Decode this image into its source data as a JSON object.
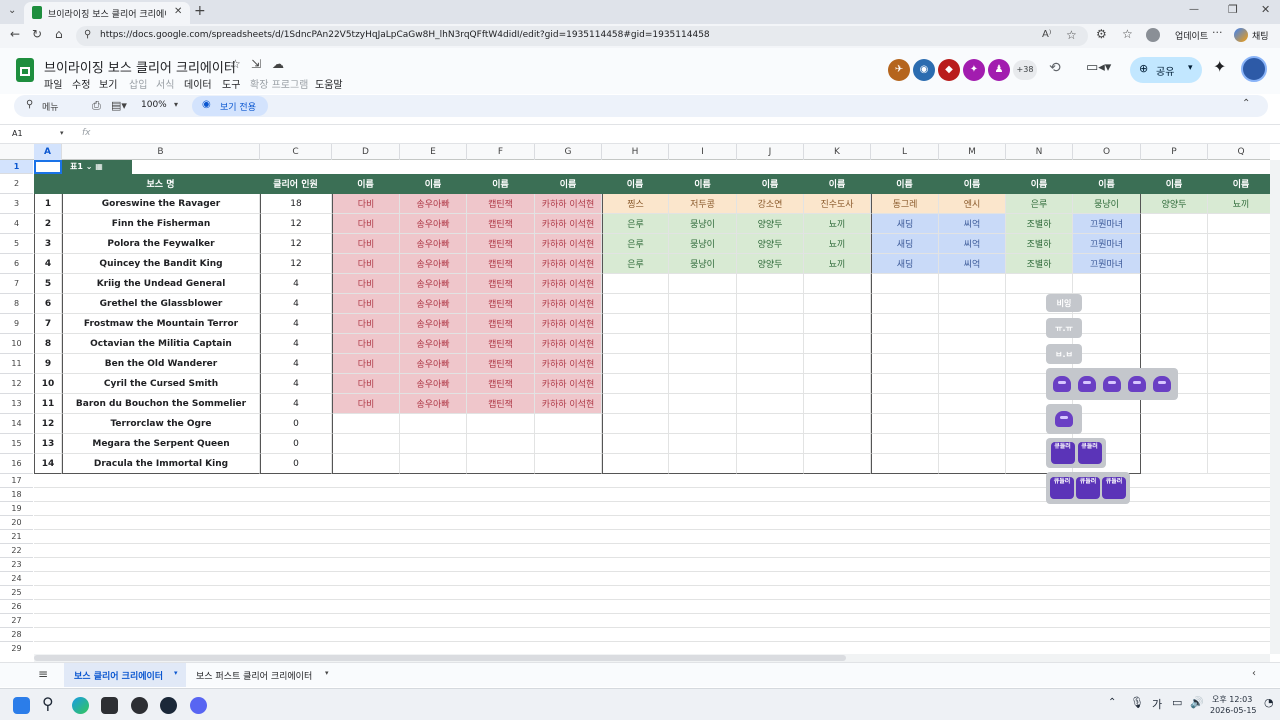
{
  "browser": {
    "tab_title": "브이라이징 보스 클리어 크리에이",
    "url": "https://docs.google.com/spreadsheets/d/1SdncPAn22V5tzyHqJaLpCaGw8H_lhN3rqQFftW4didI/edit?gid=1935114458#gid=1935114458",
    "update_label": "업데이트",
    "chat_label": "채팅"
  },
  "app": {
    "doc_title": "브이라이징 보스 클리어 크리에이터",
    "menus": [
      "파일",
      "수정",
      "보기",
      "삽입",
      "서식",
      "데이터",
      "도구",
      "확장 프로그램",
      "도움말"
    ],
    "collaborator_count": "+38",
    "share_label": "공유"
  },
  "toolbar": {
    "search_label": "메뉴",
    "zoom": "100%",
    "view_only_label": "보기 전용"
  },
  "formula": {
    "cell_ref": "A1",
    "fx": "fx"
  },
  "grid": {
    "columns": [
      "A",
      "B",
      "C",
      "D",
      "E",
      "F",
      "G",
      "H",
      "I",
      "J",
      "K",
      "L",
      "M",
      "N",
      "O",
      "P",
      "Q"
    ],
    "rows": [
      "1",
      "2",
      "3",
      "4",
      "5",
      "6",
      "7",
      "8",
      "9",
      "10",
      "11",
      "12",
      "13",
      "14",
      "15",
      "16",
      "17",
      "18",
      "19",
      "20",
      "21",
      "22",
      "23",
      "24",
      "25",
      "26",
      "27",
      "28",
      "29"
    ],
    "table_label": "표1",
    "header": [
      "",
      "보스 명",
      "클리어 인원",
      "이름",
      "이름",
      "이름",
      "이름",
      "이름",
      "이름",
      "이름",
      "이름",
      "이름",
      "이름",
      "이름",
      "이름",
      "이름",
      "이름"
    ],
    "bosses": [
      {
        "no": "1",
        "name": "Goreswine the Ravager",
        "count": "18"
      },
      {
        "no": "2",
        "name": "Finn the Fisherman",
        "count": "12"
      },
      {
        "no": "3",
        "name": "Polora the Feywalker",
        "count": "12"
      },
      {
        "no": "4",
        "name": "Quincey the Bandit King",
        "count": "12"
      },
      {
        "no": "5",
        "name": "Kriig the Undead General",
        "count": "4"
      },
      {
        "no": "6",
        "name": "Grethel the Glassblower",
        "count": "4"
      },
      {
        "no": "7",
        "name": "Frostmaw the Mountain Terror",
        "count": "4"
      },
      {
        "no": "8",
        "name": "Octavian the Militia Captain",
        "count": "4"
      },
      {
        "no": "9",
        "name": "Ben the Old Wanderer",
        "count": "4"
      },
      {
        "no": "10",
        "name": "Cyril the Cursed Smith",
        "count": "4"
      },
      {
        "no": "11",
        "name": "Baron du Bouchon the Sommelier",
        "count": "4"
      },
      {
        "no": "12",
        "name": "Terrorclaw the Ogre",
        "count": "0"
      },
      {
        "no": "13",
        "name": "Megara the Serpent Queen",
        "count": "0"
      },
      {
        "no": "14",
        "name": "Dracula the Immortal King",
        "count": "0"
      }
    ],
    "pink_names": [
      "다비",
      "송우아빠",
      "캡틴잭",
      "카하하 이석현"
    ],
    "row3_extra": [
      "찡스",
      "저두콩",
      "강소연",
      "진수도사",
      "동그레",
      "엔시",
      "은루",
      "뭉냥이",
      "양양두",
      "뇨끼"
    ],
    "row456_extra": [
      "은루",
      "뭉냥이",
      "양양두",
      "뇨끼",
      "새딩",
      "씨억",
      "조별하",
      "끄뭔마녀"
    ]
  },
  "floaters": {
    "label1": "비잉",
    "label2": "ㅠ.ㅠ",
    "label3": "ㅂ.ㅂ",
    "q_label": "큐들러"
  },
  "sheets": {
    "tab1": "보스 클리어 크리에이터",
    "tab2": "보스 퍼스트 클리어 크리에이터"
  },
  "taskbar": {
    "ime": "가",
    "time": "오후 12:03",
    "date": "2026-05-15"
  },
  "colors": {
    "header_green": "#3b6f55",
    "pink": "#efc6cb",
    "peach": "#fbe6cc",
    "green": "#d8ead3",
    "blue": "#c9daf8"
  }
}
